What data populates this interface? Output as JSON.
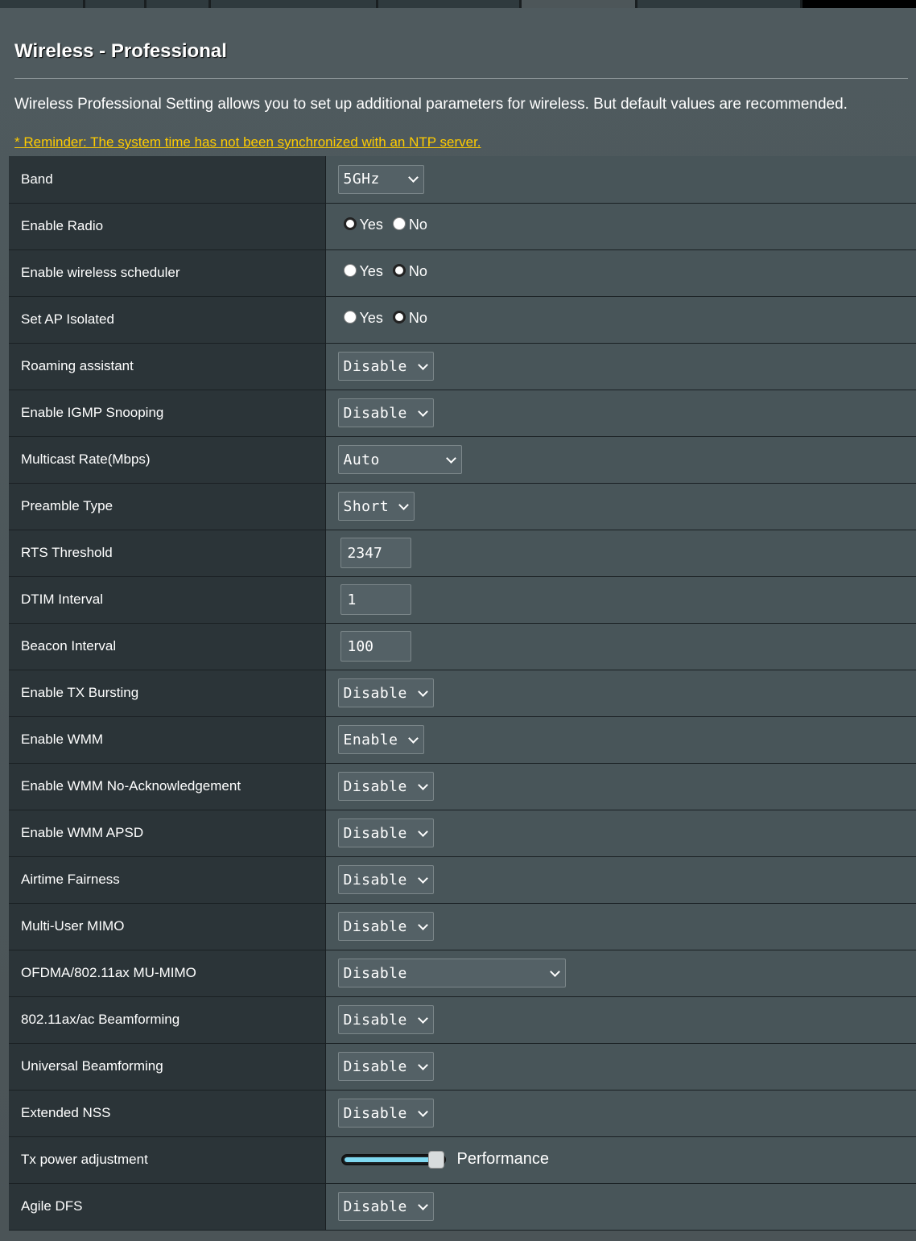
{
  "page": {
    "title": "Wireless - Professional",
    "description": "Wireless Professional Setting allows you to set up additional parameters for wireless. But default values are recommended.",
    "reminder": "* Reminder: The system time has not been synchronized with an NTP server."
  },
  "radio_labels": {
    "yes": "Yes",
    "no": "No"
  },
  "settings": {
    "band": {
      "label": "Band",
      "value": "5GHz"
    },
    "enable_radio": {
      "label": "Enable Radio",
      "selected": "yes"
    },
    "wireless_scheduler": {
      "label": "Enable wireless scheduler",
      "selected": "no"
    },
    "ap_isolated": {
      "label": "Set AP Isolated",
      "selected": "no"
    },
    "roaming_assistant": {
      "label": "Roaming assistant",
      "value": "Disable"
    },
    "igmp_snooping": {
      "label": "Enable IGMP Snooping",
      "value": "Disable"
    },
    "multicast_rate": {
      "label": "Multicast Rate(Mbps)",
      "value": "Auto"
    },
    "preamble_type": {
      "label": "Preamble Type",
      "value": "Short"
    },
    "rts_threshold": {
      "label": "RTS Threshold",
      "value": "2347"
    },
    "dtim_interval": {
      "label": "DTIM Interval",
      "value": "1"
    },
    "beacon_interval": {
      "label": "Beacon Interval",
      "value": "100"
    },
    "tx_bursting": {
      "label": "Enable TX Bursting",
      "value": "Disable"
    },
    "wmm": {
      "label": "Enable WMM",
      "value": "Enable"
    },
    "wmm_no_ack": {
      "label": "Enable WMM No-Acknowledgement",
      "value": "Disable"
    },
    "wmm_apsd": {
      "label": "Enable WMM APSD",
      "value": "Disable"
    },
    "airtime_fairness": {
      "label": "Airtime Fairness",
      "value": "Disable"
    },
    "mu_mimo": {
      "label": "Multi-User MIMO",
      "value": "Disable"
    },
    "ofdma": {
      "label": "OFDMA/802.11ax MU-MIMO",
      "value": "Disable"
    },
    "beamforming": {
      "label": "802.11ax/ac Beamforming",
      "value": "Disable"
    },
    "universal_beamforming": {
      "label": "Universal Beamforming",
      "value": "Disable"
    },
    "extended_nss": {
      "label": "Extended NSS",
      "value": "Disable"
    },
    "tx_power": {
      "label": "Tx power adjustment",
      "value_text": "Performance",
      "level": 1.0
    },
    "agile_dfs": {
      "label": "Agile DFS",
      "value": "Disable"
    }
  },
  "colors": {
    "accent_reminder": "#ffcc00",
    "slider_fill": "#7fd8f0"
  }
}
